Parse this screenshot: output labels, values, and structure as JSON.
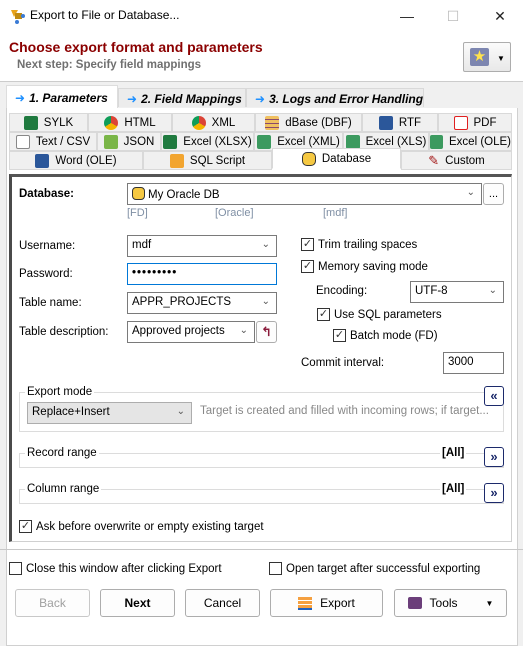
{
  "window": {
    "title": "Export to File or Database...",
    "minimize_icon": "minimize-icon",
    "maximize_icon": "maximize-icon",
    "close_icon": "close-icon"
  },
  "header": {
    "title": "Choose export format and parameters",
    "subtitle": "Next step: Specify field mappings",
    "favorites_icon": "star-icon"
  },
  "steps": [
    {
      "label": "1. Parameters",
      "active": true
    },
    {
      "label": "2. Field Mappings",
      "active": false
    },
    {
      "label": "3. Logs and Error Handling",
      "active": false
    }
  ],
  "format_tabs": {
    "row1": [
      {
        "label": "SYLK",
        "icon": "excel-sylk-icon"
      },
      {
        "label": "HTML",
        "icon": "chrome-icon"
      },
      {
        "label": "XML",
        "icon": "chrome-icon"
      },
      {
        "label": "dBase (DBF)",
        "icon": "table-icon"
      },
      {
        "label": "RTF",
        "icon": "word-icon"
      },
      {
        "label": "PDF",
        "icon": "pdf-icon"
      }
    ],
    "row2": [
      {
        "label": "Text / CSV",
        "icon": "text-file-icon"
      },
      {
        "label": "JSON",
        "icon": "notepad-icon"
      },
      {
        "label": "Excel (XLSX)",
        "icon": "excel-icon"
      },
      {
        "label": "Excel (XML)",
        "icon": "excel-icon"
      },
      {
        "label": "Excel (XLS)",
        "icon": "excel-icon"
      },
      {
        "label": "Excel (OLE)",
        "icon": "excel-icon"
      }
    ],
    "row3": [
      {
        "label": "Word (OLE)",
        "icon": "word-icon"
      },
      {
        "label": "SQL Script",
        "icon": "sql-script-icon"
      },
      {
        "label": "Database",
        "icon": "database-icon",
        "active": true
      },
      {
        "label": "Custom",
        "icon": "pencil-icon"
      }
    ]
  },
  "database": {
    "label": "Database:",
    "value": "My Oracle DB",
    "browse_label": "...",
    "tags": [
      "[FD]",
      "[Oracle]",
      "[mdf]"
    ]
  },
  "form": {
    "username_label": "Username:",
    "username_value": "mdf",
    "password_label": "Password:",
    "password_value": "•••••••••",
    "table_name_label": "Table name:",
    "table_name_value": "APPR_PROJECTS",
    "table_desc_label": "Table description:",
    "table_desc_value": "Approved projects"
  },
  "options": {
    "trim_trailing": {
      "label": "Trim trailing spaces",
      "checked": true
    },
    "memory_saving": {
      "label": "Memory saving mode",
      "checked": true
    },
    "encoding_label": "Encoding:",
    "encoding_value": "UTF-8",
    "use_sql_params": {
      "label": "Use SQL parameters",
      "checked": true
    },
    "batch_mode": {
      "label": "Batch mode (FD)",
      "checked": true
    },
    "commit_label": "Commit interval:",
    "commit_value": "3000"
  },
  "export_mode": {
    "label": "Export mode",
    "value": "Replace+Insert",
    "description": "Target is created and filled with incoming rows; if target...",
    "collapse": "«"
  },
  "record_range": {
    "label": "Record range",
    "value": "[All]",
    "expand": "»"
  },
  "column_range": {
    "label": "Column range",
    "value": "[All]",
    "expand": "»"
  },
  "ask_overwrite": {
    "label": "Ask before overwrite or empty existing target",
    "checked": true
  },
  "footer": {
    "close_after": {
      "label": "Close this window after clicking Export",
      "checked": false
    },
    "open_target": {
      "label": "Open target after successful exporting",
      "checked": false
    },
    "back": "Back",
    "next": "Next",
    "cancel": "Cancel",
    "export": "Export",
    "tools": "Tools"
  },
  "colors": {
    "header_title": "#8b0000",
    "subtitle": "#707070",
    "step_arrow": "#1e90ff",
    "expand_button": "#1c2a6b"
  }
}
